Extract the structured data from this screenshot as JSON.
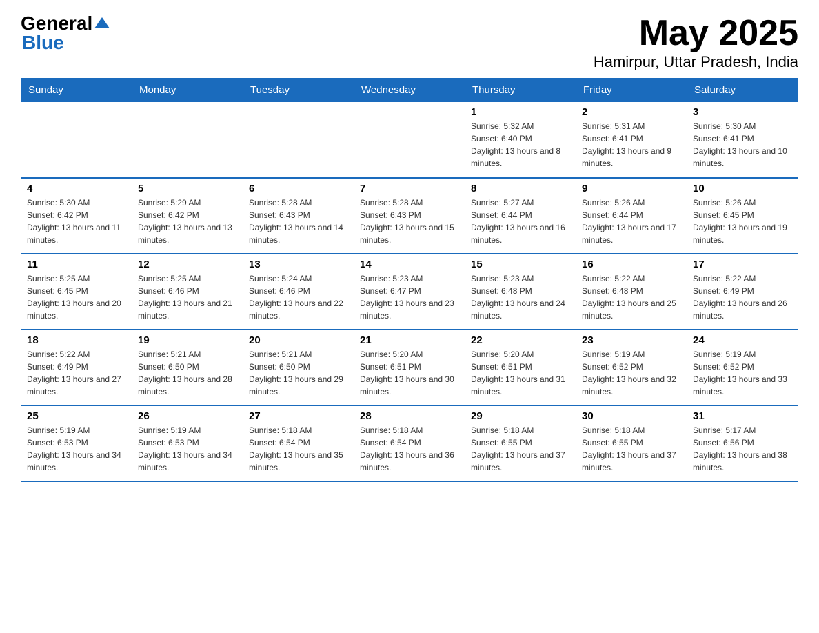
{
  "header": {
    "logo_general": "General",
    "logo_blue": "Blue",
    "title": "May 2025",
    "subtitle": "Hamirpur, Uttar Pradesh, India"
  },
  "weekdays": [
    "Sunday",
    "Monday",
    "Tuesday",
    "Wednesday",
    "Thursday",
    "Friday",
    "Saturday"
  ],
  "weeks": [
    [
      {
        "day": "",
        "info": ""
      },
      {
        "day": "",
        "info": ""
      },
      {
        "day": "",
        "info": ""
      },
      {
        "day": "",
        "info": ""
      },
      {
        "day": "1",
        "info": "Sunrise: 5:32 AM\nSunset: 6:40 PM\nDaylight: 13 hours and 8 minutes."
      },
      {
        "day": "2",
        "info": "Sunrise: 5:31 AM\nSunset: 6:41 PM\nDaylight: 13 hours and 9 minutes."
      },
      {
        "day": "3",
        "info": "Sunrise: 5:30 AM\nSunset: 6:41 PM\nDaylight: 13 hours and 10 minutes."
      }
    ],
    [
      {
        "day": "4",
        "info": "Sunrise: 5:30 AM\nSunset: 6:42 PM\nDaylight: 13 hours and 11 minutes."
      },
      {
        "day": "5",
        "info": "Sunrise: 5:29 AM\nSunset: 6:42 PM\nDaylight: 13 hours and 13 minutes."
      },
      {
        "day": "6",
        "info": "Sunrise: 5:28 AM\nSunset: 6:43 PM\nDaylight: 13 hours and 14 minutes."
      },
      {
        "day": "7",
        "info": "Sunrise: 5:28 AM\nSunset: 6:43 PM\nDaylight: 13 hours and 15 minutes."
      },
      {
        "day": "8",
        "info": "Sunrise: 5:27 AM\nSunset: 6:44 PM\nDaylight: 13 hours and 16 minutes."
      },
      {
        "day": "9",
        "info": "Sunrise: 5:26 AM\nSunset: 6:44 PM\nDaylight: 13 hours and 17 minutes."
      },
      {
        "day": "10",
        "info": "Sunrise: 5:26 AM\nSunset: 6:45 PM\nDaylight: 13 hours and 19 minutes."
      }
    ],
    [
      {
        "day": "11",
        "info": "Sunrise: 5:25 AM\nSunset: 6:45 PM\nDaylight: 13 hours and 20 minutes."
      },
      {
        "day": "12",
        "info": "Sunrise: 5:25 AM\nSunset: 6:46 PM\nDaylight: 13 hours and 21 minutes."
      },
      {
        "day": "13",
        "info": "Sunrise: 5:24 AM\nSunset: 6:46 PM\nDaylight: 13 hours and 22 minutes."
      },
      {
        "day": "14",
        "info": "Sunrise: 5:23 AM\nSunset: 6:47 PM\nDaylight: 13 hours and 23 minutes."
      },
      {
        "day": "15",
        "info": "Sunrise: 5:23 AM\nSunset: 6:48 PM\nDaylight: 13 hours and 24 minutes."
      },
      {
        "day": "16",
        "info": "Sunrise: 5:22 AM\nSunset: 6:48 PM\nDaylight: 13 hours and 25 minutes."
      },
      {
        "day": "17",
        "info": "Sunrise: 5:22 AM\nSunset: 6:49 PM\nDaylight: 13 hours and 26 minutes."
      }
    ],
    [
      {
        "day": "18",
        "info": "Sunrise: 5:22 AM\nSunset: 6:49 PM\nDaylight: 13 hours and 27 minutes."
      },
      {
        "day": "19",
        "info": "Sunrise: 5:21 AM\nSunset: 6:50 PM\nDaylight: 13 hours and 28 minutes."
      },
      {
        "day": "20",
        "info": "Sunrise: 5:21 AM\nSunset: 6:50 PM\nDaylight: 13 hours and 29 minutes."
      },
      {
        "day": "21",
        "info": "Sunrise: 5:20 AM\nSunset: 6:51 PM\nDaylight: 13 hours and 30 minutes."
      },
      {
        "day": "22",
        "info": "Sunrise: 5:20 AM\nSunset: 6:51 PM\nDaylight: 13 hours and 31 minutes."
      },
      {
        "day": "23",
        "info": "Sunrise: 5:19 AM\nSunset: 6:52 PM\nDaylight: 13 hours and 32 minutes."
      },
      {
        "day": "24",
        "info": "Sunrise: 5:19 AM\nSunset: 6:52 PM\nDaylight: 13 hours and 33 minutes."
      }
    ],
    [
      {
        "day": "25",
        "info": "Sunrise: 5:19 AM\nSunset: 6:53 PM\nDaylight: 13 hours and 34 minutes."
      },
      {
        "day": "26",
        "info": "Sunrise: 5:19 AM\nSunset: 6:53 PM\nDaylight: 13 hours and 34 minutes."
      },
      {
        "day": "27",
        "info": "Sunrise: 5:18 AM\nSunset: 6:54 PM\nDaylight: 13 hours and 35 minutes."
      },
      {
        "day": "28",
        "info": "Sunrise: 5:18 AM\nSunset: 6:54 PM\nDaylight: 13 hours and 36 minutes."
      },
      {
        "day": "29",
        "info": "Sunrise: 5:18 AM\nSunset: 6:55 PM\nDaylight: 13 hours and 37 minutes."
      },
      {
        "day": "30",
        "info": "Sunrise: 5:18 AM\nSunset: 6:55 PM\nDaylight: 13 hours and 37 minutes."
      },
      {
        "day": "31",
        "info": "Sunrise: 5:17 AM\nSunset: 6:56 PM\nDaylight: 13 hours and 38 minutes."
      }
    ]
  ]
}
